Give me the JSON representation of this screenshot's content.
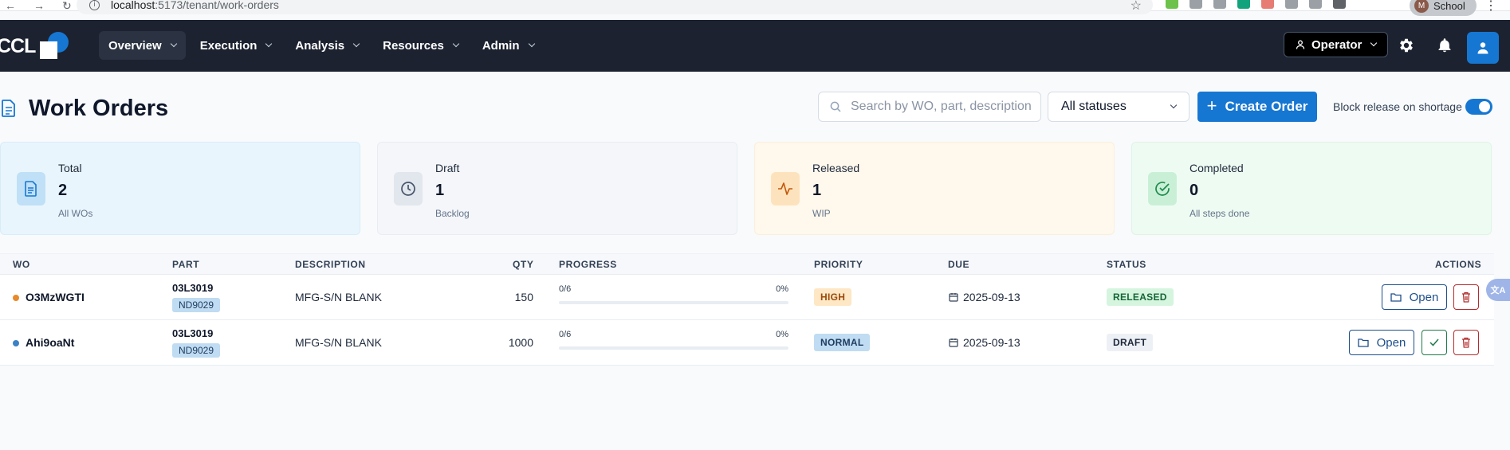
{
  "browser": {
    "url_host": "localhost",
    "url_path": ":5173/tenant/work-orders",
    "profile_initial": "M",
    "profile_name": "School"
  },
  "header": {
    "logo_text": "CCL",
    "nav": [
      {
        "label": "Overview",
        "active": true
      },
      {
        "label": "Execution"
      },
      {
        "label": "Analysis"
      },
      {
        "label": "Resources"
      },
      {
        "label": "Admin"
      }
    ],
    "role_label": "Operator"
  },
  "page": {
    "title": "Work Orders",
    "search_placeholder": "Search by WO, part, description",
    "status_filter": "All statuses",
    "create_label": "Create Order",
    "block_release_label": "Block release on shortage",
    "block_release_on": true
  },
  "stats": [
    {
      "label": "Total",
      "value": "2",
      "sub": "All WOs",
      "bg": "#e9f5fd",
      "border": "#d8ecf9",
      "icon_bg": "#bfe0f6",
      "icon_color": "#1677d2",
      "icon": "document-icon"
    },
    {
      "label": "Draft",
      "value": "1",
      "sub": "Backlog",
      "bg": "#f4f6f9",
      "border": "#e9edf2",
      "icon_bg": "#e2e7ee",
      "icon_color": "#475569",
      "icon": "clock-icon"
    },
    {
      "label": "Released",
      "value": "1",
      "sub": "WIP",
      "bg": "#fff8ec",
      "border": "#fbefdb",
      "icon_bg": "#fde3bd",
      "icon_color": "#c2580c",
      "icon": "activity-icon"
    },
    {
      "label": "Completed",
      "value": "0",
      "sub": "All steps done",
      "bg": "#eefbf2",
      "border": "#dff4e6",
      "icon_bg": "#c9f0d7",
      "icon_color": "#1f8a4c",
      "icon": "check-circle-icon"
    }
  ],
  "table": {
    "columns": [
      "WO",
      "PART",
      "DESCRIPTION",
      "QTY",
      "PROGRESS",
      "PRIORITY",
      "DUE",
      "STATUS",
      "ACTIONS"
    ],
    "rows": [
      {
        "wo": "O3MzWGTI",
        "dot_color": "#e8892b",
        "part": "03L3019",
        "part_tag": "ND9029",
        "description": "MFG-S/N BLANK",
        "qty": "150",
        "progress_steps": "0/6",
        "progress_pct": "0%",
        "progress": 0,
        "priority": "HIGH",
        "priority_bg": "#fde7c4",
        "priority_color": "#9a4a0b",
        "due": "2025-09-13",
        "status": "RELEASED",
        "status_bg": "#d5f5df",
        "status_color": "#166534",
        "open_label": "Open",
        "can_complete": false
      },
      {
        "wo": "Ahi9oaNt",
        "dot_color": "#3b82c4",
        "part": "03L3019",
        "part_tag": "ND9029",
        "description": "MFG-S/N BLANK",
        "qty": "1000",
        "progress_steps": "0/6",
        "progress_pct": "0%",
        "progress": 0,
        "priority": "NORMAL",
        "priority_bg": "#bfdcf2",
        "priority_color": "#1e3a5f",
        "due": "2025-09-13",
        "status": "DRAFT",
        "status_bg": "#edf0f4",
        "status_color": "#1e293b",
        "open_label": "Open",
        "can_complete": true
      }
    ]
  }
}
